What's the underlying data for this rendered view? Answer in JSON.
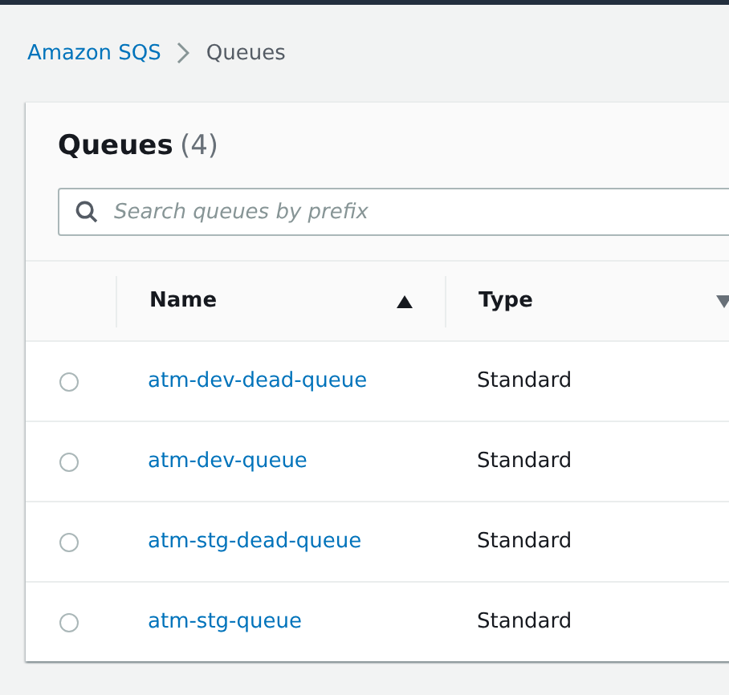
{
  "breadcrumb": [
    {
      "label": "Amazon SQS",
      "kind": "link"
    },
    {
      "label": "Queues",
      "kind": "current"
    }
  ],
  "panel": {
    "title": "Queues",
    "count": "(4)"
  },
  "search": {
    "placeholder": "Search queues by prefix"
  },
  "table": {
    "columns": [
      {
        "label": "Name",
        "sorted": true
      },
      {
        "label": "Type",
        "sorted": false
      }
    ],
    "rows": [
      {
        "name": "atm-dev-dead-queue",
        "type": "Standard",
        "selected": false
      },
      {
        "name": "atm-dev-queue",
        "type": "Standard",
        "selected": false
      },
      {
        "name": "atm-stg-dead-queue",
        "type": "Standard",
        "selected": false
      },
      {
        "name": "atm-stg-queue",
        "type": "Standard",
        "selected": false
      }
    ]
  }
}
